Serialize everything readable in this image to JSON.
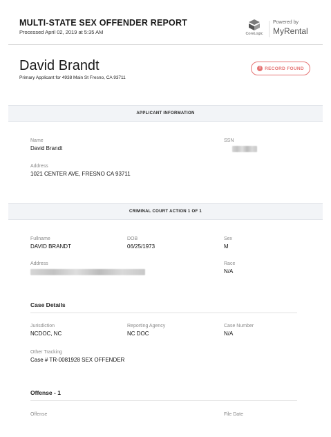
{
  "header": {
    "title": "MULTI-STATE SEX OFFENDER REPORT",
    "processed": "Processed April 02, 2019 at 5:35 AM",
    "brand_small": "CoreLogic",
    "powered_by": "Powered by",
    "brand_name": "MyRental",
    "icon": "corelogic-logo-icon"
  },
  "applicant": {
    "name": "David Brandt",
    "subtitle": "Primary Applicant for 4938 Main St Fresno, CA 93711",
    "status_badge": "RECORD FOUND",
    "status_icon": "alert-circle-icon",
    "status_color": "#e57373"
  },
  "applicant_info": {
    "section_title": "APPLICANT INFORMATION",
    "name_label": "Name",
    "name_value": "David Brandt",
    "ssn_label": "SSN",
    "address_label": "Address",
    "address_value": "1021 CENTER AVE, FRESNO CA 93711"
  },
  "court_action": {
    "section_title": "CRIMINAL COURT ACTION 1 OF 1",
    "fullname_label": "Fullname",
    "fullname_value": "DAVID BRANDT",
    "dob_label": "DOB",
    "dob_value": "06/25/1973",
    "sex_label": "Sex",
    "sex_value": "M",
    "address_label": "Address",
    "race_label": "Race",
    "race_value": "N/A"
  },
  "case_details": {
    "heading": "Case Details",
    "jurisdiction_label": "Jurisdiction",
    "jurisdiction_value": "NCDOC, NC",
    "agency_label": "Reporting Agency",
    "agency_value": "NC DOC",
    "case_number_label": "Case Number",
    "case_number_value": "N/A",
    "tracking_label": "Other Tracking",
    "tracking_value": "Case # TR-0081928 SEX OFFENDER"
  },
  "offense": {
    "heading": "Offense - 1",
    "offense_label": "Offense",
    "file_date_label": "File Date"
  }
}
